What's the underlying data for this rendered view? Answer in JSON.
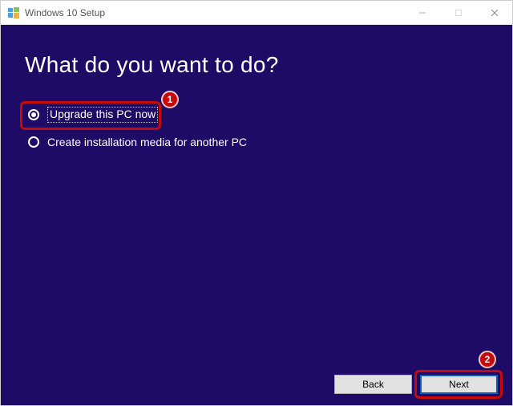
{
  "window": {
    "title": "Windows 10 Setup"
  },
  "heading": "What do you want to do?",
  "options": {
    "upgrade": {
      "label": "Upgrade this PC now",
      "selected": true
    },
    "media": {
      "label": "Create installation media for another PC",
      "selected": false
    }
  },
  "buttons": {
    "back": "Back",
    "next": "Next"
  },
  "annotations": {
    "marker1": "1",
    "marker2": "2"
  }
}
